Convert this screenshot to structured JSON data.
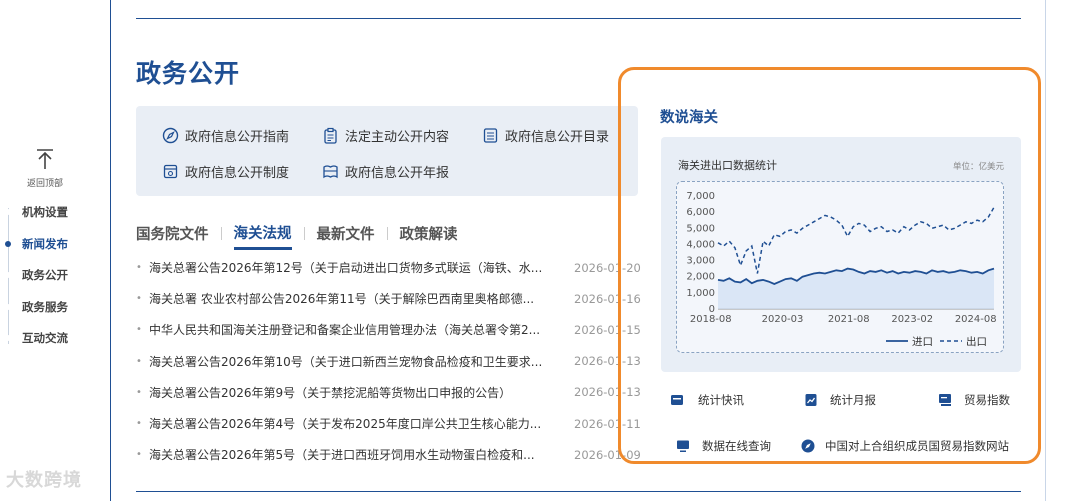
{
  "back_to_top": "返回顶部",
  "side_nav": [
    "机构设置",
    "新闻发布",
    "政务公开",
    "政务服务",
    "互动交流"
  ],
  "section_title": "政务公开",
  "quick_links": [
    {
      "label": "政府信息公开指南",
      "icon": "compass-icon"
    },
    {
      "label": "法定主动公开内容",
      "icon": "clipboard-icon"
    },
    {
      "label": "政府信息公开目录",
      "icon": "list-document-icon"
    },
    {
      "label": "政府信息公开制度",
      "icon": "settings-document-icon"
    },
    {
      "label": "政府信息公开年报",
      "icon": "book-icon"
    }
  ],
  "tabs": [
    "国务院文件",
    "海关法规",
    "最新文件",
    "政策解读"
  ],
  "news": [
    {
      "title": "海关总署公告2026年第12号（关于启动进出口货物多式联运（海铁、水...",
      "date": "2026-01-20"
    },
    {
      "title": "海关总署 农业农村部公告2026年第11号（关于解除巴西南里奥格郎德...",
      "date": "2026-01-16"
    },
    {
      "title": "中华人民共和国海关注册登记和备案企业信用管理办法（海关总署令第2...",
      "date": "2026-01-15"
    },
    {
      "title": "海关总署公告2026年第10号（关于进口新西兰宠物食品检疫和卫生要求...",
      "date": "2026-01-13"
    },
    {
      "title": "海关总署公告2026年第9号（关于禁挖泥船等货物出口申报的公告）",
      "date": "2026-01-13"
    },
    {
      "title": "海关总署公告2026年第4号（关于发布2025年度口岸公共卫生核心能力...",
      "date": "2026-01-11"
    },
    {
      "title": "海关总署公告2026年第5号（关于进口西班牙饲用水生动物蛋白检疫和...",
      "date": "2026-01-09"
    }
  ],
  "panel_title": "数说海关",
  "chart_card_title": "海关进出口数据统计",
  "chart_unit": "单位：亿美元",
  "stat_links": [
    {
      "label": "统计快讯",
      "icon": "document-icon"
    },
    {
      "label": "统计月报",
      "icon": "chart-report-icon"
    },
    {
      "label": "贸易指数",
      "icon": "index-icon"
    },
    {
      "label": "数据在线查询",
      "icon": "monitor-icon"
    },
    {
      "label": "中国对上合组织成员国贸易指数网站",
      "icon": "compass-icon"
    }
  ],
  "watermark": "大数跨境",
  "colors": {
    "accent": "#1f4f93",
    "highlight_frame": "#f08a2c",
    "card_bg": "#e8eef6"
  },
  "chart_data": {
    "type": "line",
    "title": "海关进出口数据统计",
    "unit": "单位：亿美元",
    "x_ticks": [
      "2018-08",
      "2020-03",
      "2021-08",
      "2023-02",
      "2024-08"
    ],
    "y_ticks": [
      "0",
      "1,000",
      "2,000",
      "3,000",
      "4,000",
      "5,000",
      "6,000",
      "7,000"
    ],
    "ylim": [
      0,
      7000
    ],
    "legend": [
      "进口",
      "出口"
    ],
    "x_range": [
      "2018-08",
      "2025-12"
    ],
    "series": [
      {
        "name": "进口",
        "style": "solid",
        "values": [
          1800,
          1750,
          1900,
          1700,
          1650,
          1850,
          1600,
          1750,
          1800,
          1700,
          1550,
          1700,
          1850,
          1900,
          1750,
          2000,
          2100,
          2200,
          2250,
          2200,
          2300,
          2400,
          2350,
          2500,
          2450,
          2300,
          2200,
          2350,
          2300,
          2400,
          2250,
          2350,
          2200,
          2300,
          2250,
          2350,
          2300,
          2200,
          2400,
          2300,
          2350,
          2250,
          2300,
          2400,
          2350,
          2250,
          2300,
          2200,
          2400,
          2500
        ]
      },
      {
        "name": "出口",
        "style": "dashed",
        "values": [
          4100,
          3900,
          4200,
          3800,
          2700,
          3600,
          3900,
          2200,
          4200,
          3900,
          4600,
          4500,
          4800,
          4900,
          4700,
          5000,
          5200,
          5400,
          5600,
          5800,
          5700,
          5500,
          5200,
          4500,
          5100,
          5300,
          5200,
          4800,
          5000,
          5100,
          4800,
          4900,
          4700,
          5100,
          4900,
          5200,
          5400,
          5300,
          5000,
          5100,
          5200,
          4900,
          5000,
          5200,
          5400,
          5300,
          5500,
          5400,
          5700,
          6300
        ]
      }
    ]
  }
}
